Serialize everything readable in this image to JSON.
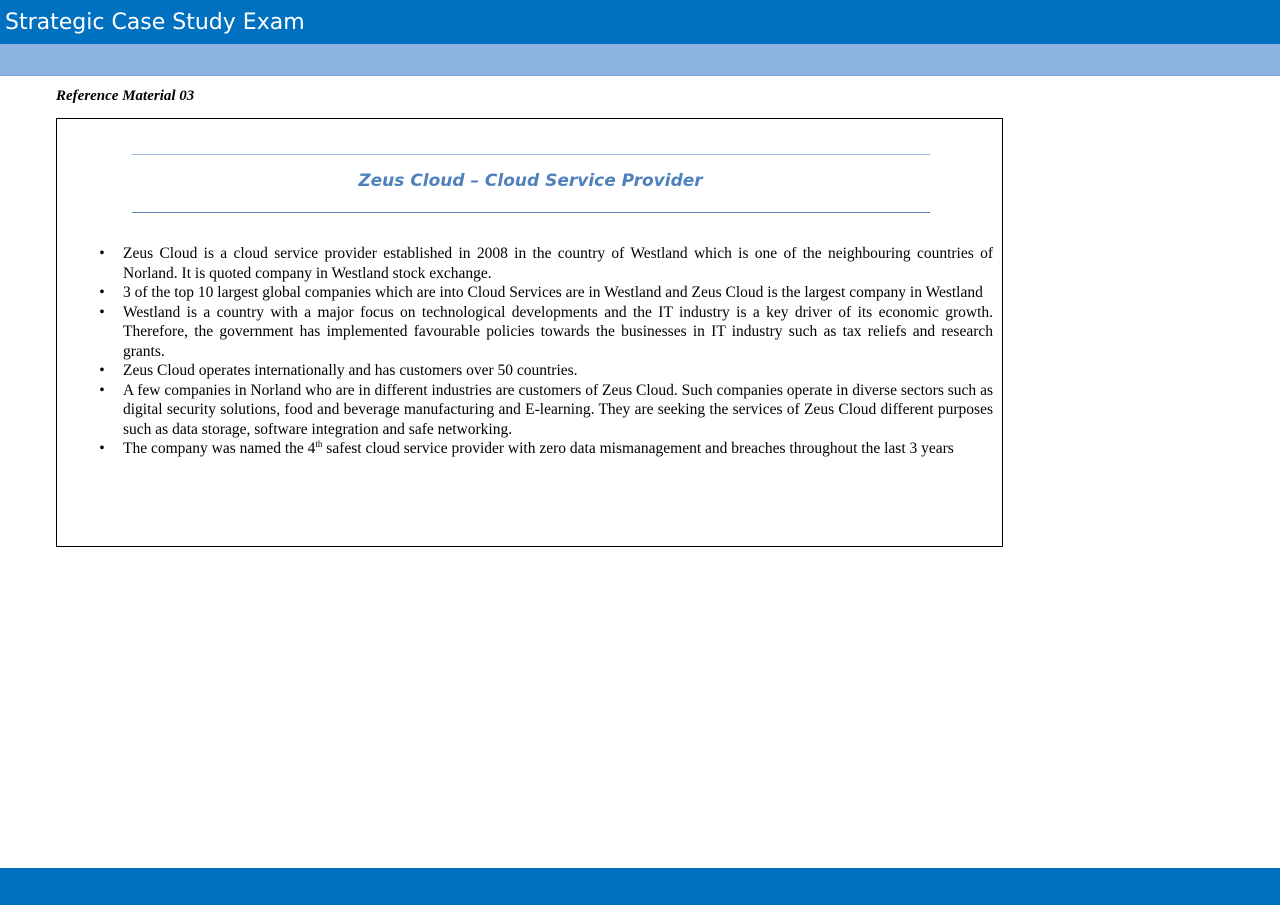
{
  "header": {
    "title": "Strategic Case Study Exam"
  },
  "reference": {
    "label": "Reference Material 03",
    "heading": "Zeus Cloud – Cloud Service Provider",
    "bullets": [
      "Zeus Cloud is a cloud service provider established in 2008 in the country of Westland which is one of the neighbouring countries of Norland. It is quoted company in Westland stock exchange.",
      "3 of the top 10 largest global companies which are into Cloud Services are in Westland and Zeus Cloud is the largest company in Westland",
      "Westland is a country with a major focus on technological developments and the IT industry is a key driver of its economic growth. Therefore, the government has implemented favourable policies towards the businesses in IT industry such as tax reliefs and research grants.",
      "Zeus Cloud operates internationally and has customers over 50 countries.",
      "A few companies in Norland who are in different industries are customers of Zeus Cloud. Such companies operate in diverse sectors such as digital security solutions, food and beverage manufacturing and E-learning. They are seeking the services of Zeus Cloud different purposes such as data storage, software integration and safe networking."
    ],
    "last_bullet": {
      "before": "The company was named the 4",
      "sup": "th",
      "after": " safest cloud service provider with zero data mismanagement and breaches throughout the last 3 years"
    },
    "bullet_char": "•"
  },
  "colors": {
    "title_bar": "#0070c0",
    "sub_bar": "#8db3e2",
    "heading": "#4f81bd"
  }
}
